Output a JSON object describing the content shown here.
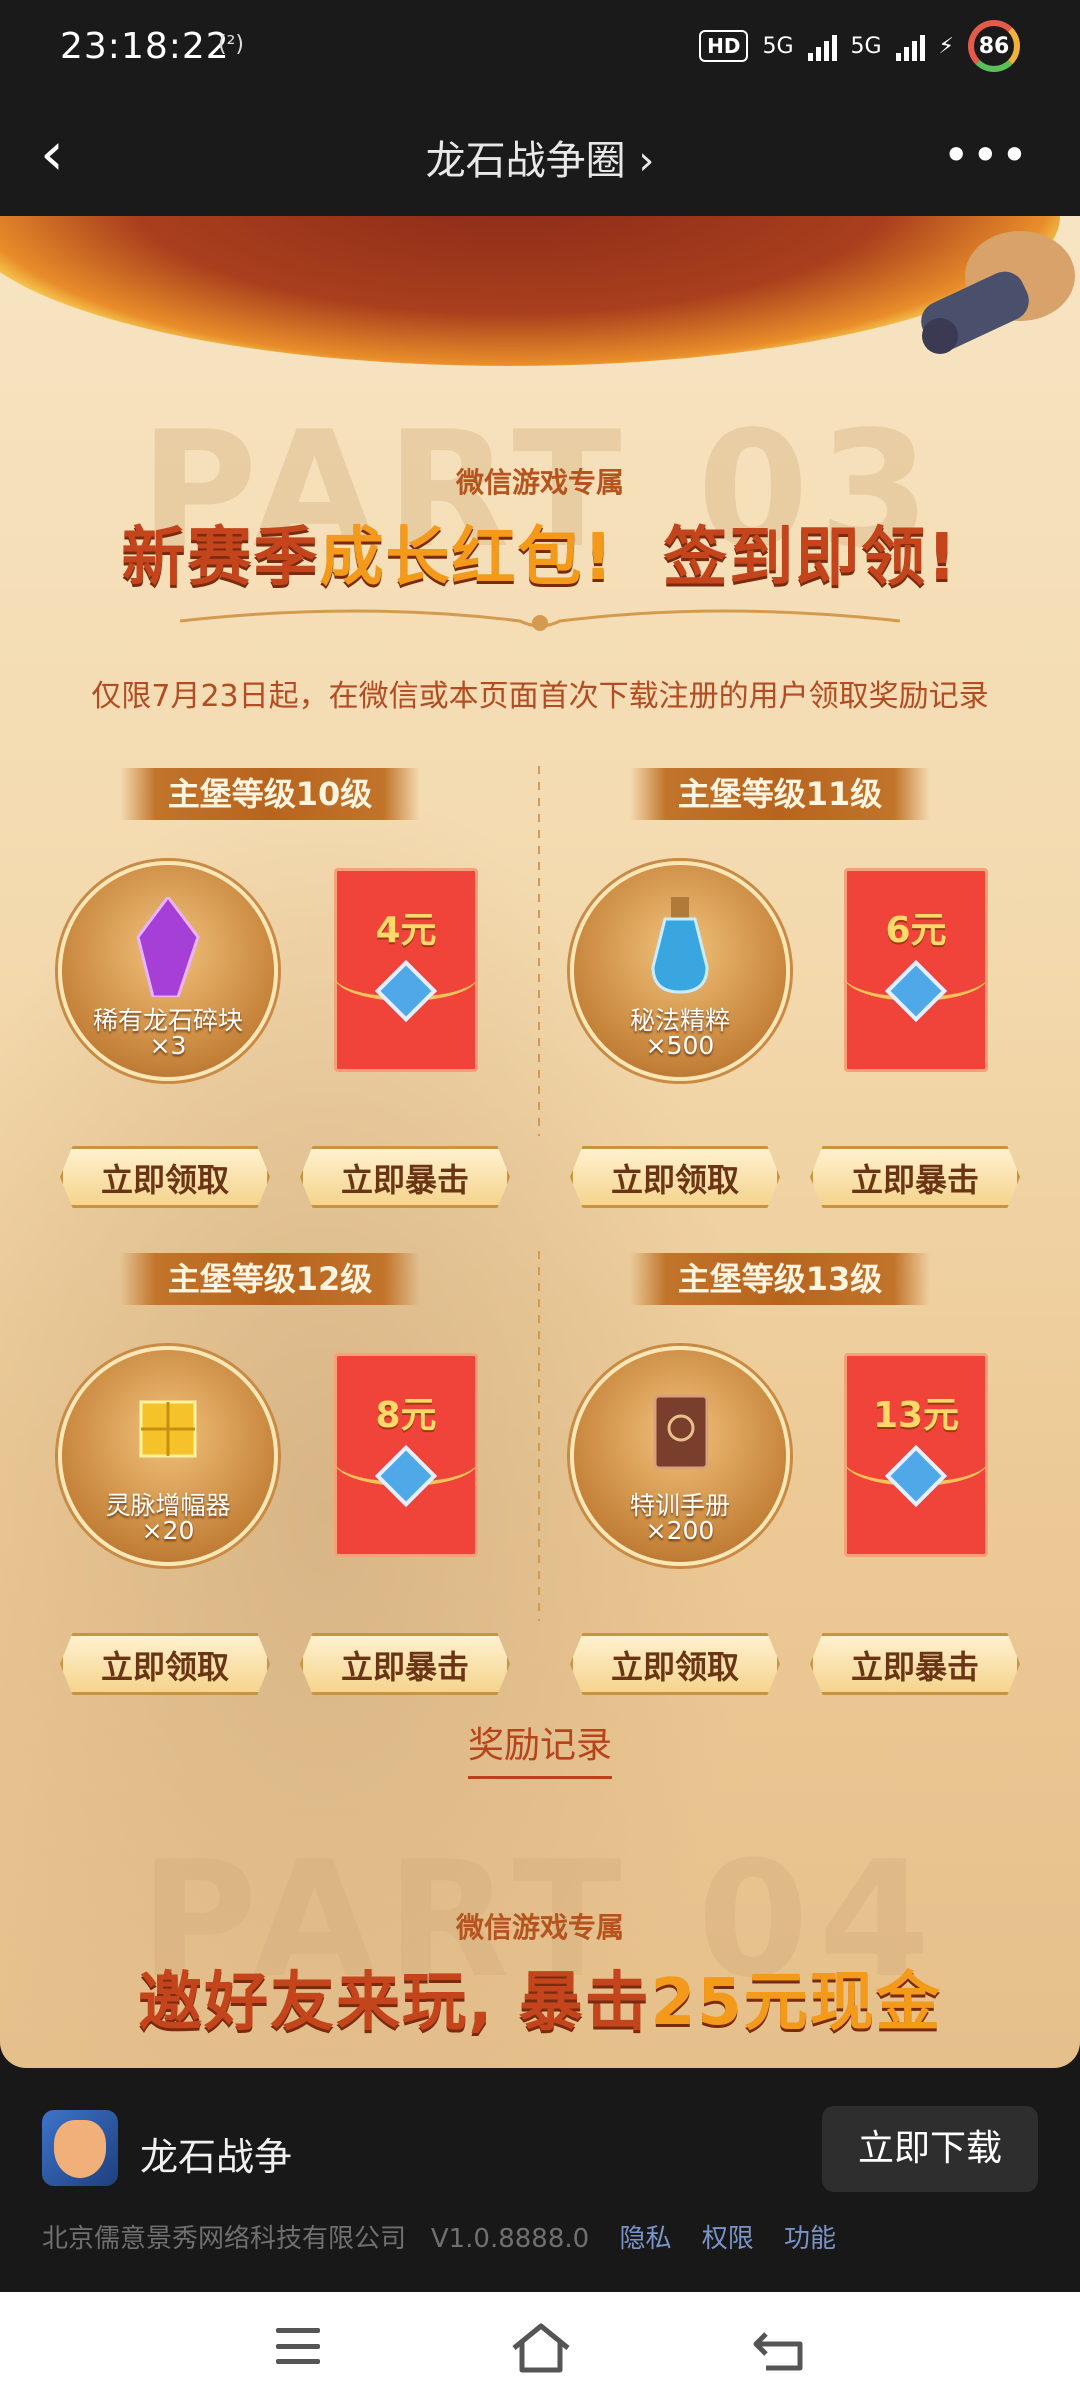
{
  "status": {
    "time": "23:18:22",
    "small": "(²)",
    "hd": "HD",
    "net1": "5G",
    "net2": "5G",
    "battery": "86"
  },
  "header": {
    "back_icon": "chevron-left-icon",
    "title": "龙石战争圈",
    "title_chevron": "›",
    "more_icon": "more-dots-icon"
  },
  "event": {
    "part_top": "PART 03",
    "tag": "微信游戏专属",
    "headline_a": "新赛季",
    "headline_b": "成长红包!",
    "headline_c": "签到即领!",
    "notice": "仅限7月23日起，在微信或本页面首次下载注册的用户领取奖励记录",
    "rewards": [
      {
        "level": "主堡等级10级",
        "item": "稀有龙石碎块",
        "qty": "×3",
        "amount": "4元",
        "claim": "立即领取",
        "crit": "立即暴击",
        "gem": "crystal"
      },
      {
        "level": "主堡等级11级",
        "item": "秘法精粹",
        "qty": "×500",
        "amount": "6元",
        "claim": "立即领取",
        "crit": "立即暴击",
        "gem": "potion"
      },
      {
        "level": "主堡等级12级",
        "item": "灵脉增幅器",
        "qty": "×20",
        "amount": "8元",
        "claim": "立即领取",
        "crit": "立即暴击",
        "gem": "cube"
      },
      {
        "level": "主堡等级13级",
        "item": "特训手册",
        "qty": "×200",
        "amount": "13元",
        "claim": "立即领取",
        "crit": "立即暴击",
        "gem": "book"
      }
    ],
    "record_label": "奖励记录",
    "part_bottom": "PART 04",
    "tag2": "微信游戏专属",
    "invite_a": "邀好友来玩,",
    "invite_b": "暴击",
    "invite_c": "25元现金"
  },
  "app": {
    "name": "龙石战争",
    "download": "立即下载",
    "company": "北京儒意景秀网络科技有限公司",
    "version": "V1.0.8888.0",
    "links": [
      "隐私",
      "权限",
      "功能"
    ]
  },
  "nav": {
    "menu_icon": "menu-icon",
    "home_icon": "home-icon",
    "back_icon": "back-icon"
  },
  "colors": {
    "accent": "#c4451c",
    "gold": "#f39a1a",
    "red_packet": "#f0443a"
  }
}
